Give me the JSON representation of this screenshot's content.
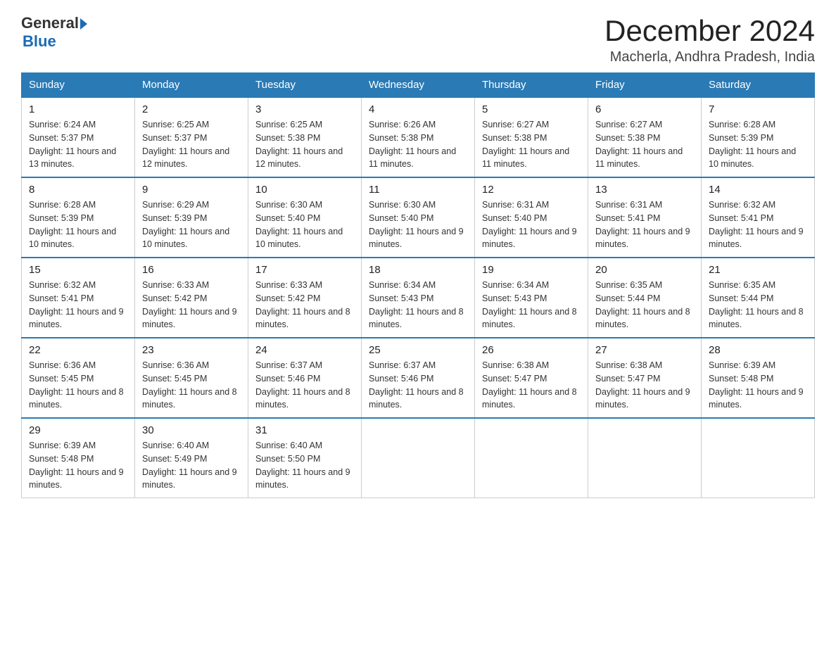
{
  "header": {
    "logo": {
      "general": "General",
      "blue": "Blue"
    },
    "title": "December 2024",
    "location": "Macherla, Andhra Pradesh, India"
  },
  "days_of_week": [
    "Sunday",
    "Monday",
    "Tuesday",
    "Wednesday",
    "Thursday",
    "Friday",
    "Saturday"
  ],
  "weeks": [
    [
      {
        "day": "1",
        "sunrise": "6:24 AM",
        "sunset": "5:37 PM",
        "daylight": "11 hours and 13 minutes."
      },
      {
        "day": "2",
        "sunrise": "6:25 AM",
        "sunset": "5:37 PM",
        "daylight": "11 hours and 12 minutes."
      },
      {
        "day": "3",
        "sunrise": "6:25 AM",
        "sunset": "5:38 PM",
        "daylight": "11 hours and 12 minutes."
      },
      {
        "day": "4",
        "sunrise": "6:26 AM",
        "sunset": "5:38 PM",
        "daylight": "11 hours and 11 minutes."
      },
      {
        "day": "5",
        "sunrise": "6:27 AM",
        "sunset": "5:38 PM",
        "daylight": "11 hours and 11 minutes."
      },
      {
        "day": "6",
        "sunrise": "6:27 AM",
        "sunset": "5:38 PM",
        "daylight": "11 hours and 11 minutes."
      },
      {
        "day": "7",
        "sunrise": "6:28 AM",
        "sunset": "5:39 PM",
        "daylight": "11 hours and 10 minutes."
      }
    ],
    [
      {
        "day": "8",
        "sunrise": "6:28 AM",
        "sunset": "5:39 PM",
        "daylight": "11 hours and 10 minutes."
      },
      {
        "day": "9",
        "sunrise": "6:29 AM",
        "sunset": "5:39 PM",
        "daylight": "11 hours and 10 minutes."
      },
      {
        "day": "10",
        "sunrise": "6:30 AM",
        "sunset": "5:40 PM",
        "daylight": "11 hours and 10 minutes."
      },
      {
        "day": "11",
        "sunrise": "6:30 AM",
        "sunset": "5:40 PM",
        "daylight": "11 hours and 9 minutes."
      },
      {
        "day": "12",
        "sunrise": "6:31 AM",
        "sunset": "5:40 PM",
        "daylight": "11 hours and 9 minutes."
      },
      {
        "day": "13",
        "sunrise": "6:31 AM",
        "sunset": "5:41 PM",
        "daylight": "11 hours and 9 minutes."
      },
      {
        "day": "14",
        "sunrise": "6:32 AM",
        "sunset": "5:41 PM",
        "daylight": "11 hours and 9 minutes."
      }
    ],
    [
      {
        "day": "15",
        "sunrise": "6:32 AM",
        "sunset": "5:41 PM",
        "daylight": "11 hours and 9 minutes."
      },
      {
        "day": "16",
        "sunrise": "6:33 AM",
        "sunset": "5:42 PM",
        "daylight": "11 hours and 9 minutes."
      },
      {
        "day": "17",
        "sunrise": "6:33 AM",
        "sunset": "5:42 PM",
        "daylight": "11 hours and 8 minutes."
      },
      {
        "day": "18",
        "sunrise": "6:34 AM",
        "sunset": "5:43 PM",
        "daylight": "11 hours and 8 minutes."
      },
      {
        "day": "19",
        "sunrise": "6:34 AM",
        "sunset": "5:43 PM",
        "daylight": "11 hours and 8 minutes."
      },
      {
        "day": "20",
        "sunrise": "6:35 AM",
        "sunset": "5:44 PM",
        "daylight": "11 hours and 8 minutes."
      },
      {
        "day": "21",
        "sunrise": "6:35 AM",
        "sunset": "5:44 PM",
        "daylight": "11 hours and 8 minutes."
      }
    ],
    [
      {
        "day": "22",
        "sunrise": "6:36 AM",
        "sunset": "5:45 PM",
        "daylight": "11 hours and 8 minutes."
      },
      {
        "day": "23",
        "sunrise": "6:36 AM",
        "sunset": "5:45 PM",
        "daylight": "11 hours and 8 minutes."
      },
      {
        "day": "24",
        "sunrise": "6:37 AM",
        "sunset": "5:46 PM",
        "daylight": "11 hours and 8 minutes."
      },
      {
        "day": "25",
        "sunrise": "6:37 AM",
        "sunset": "5:46 PM",
        "daylight": "11 hours and 8 minutes."
      },
      {
        "day": "26",
        "sunrise": "6:38 AM",
        "sunset": "5:47 PM",
        "daylight": "11 hours and 8 minutes."
      },
      {
        "day": "27",
        "sunrise": "6:38 AM",
        "sunset": "5:47 PM",
        "daylight": "11 hours and 9 minutes."
      },
      {
        "day": "28",
        "sunrise": "6:39 AM",
        "sunset": "5:48 PM",
        "daylight": "11 hours and 9 minutes."
      }
    ],
    [
      {
        "day": "29",
        "sunrise": "6:39 AM",
        "sunset": "5:48 PM",
        "daylight": "11 hours and 9 minutes."
      },
      {
        "day": "30",
        "sunrise": "6:40 AM",
        "sunset": "5:49 PM",
        "daylight": "11 hours and 9 minutes."
      },
      {
        "day": "31",
        "sunrise": "6:40 AM",
        "sunset": "5:50 PM",
        "daylight": "11 hours and 9 minutes."
      },
      null,
      null,
      null,
      null
    ]
  ]
}
